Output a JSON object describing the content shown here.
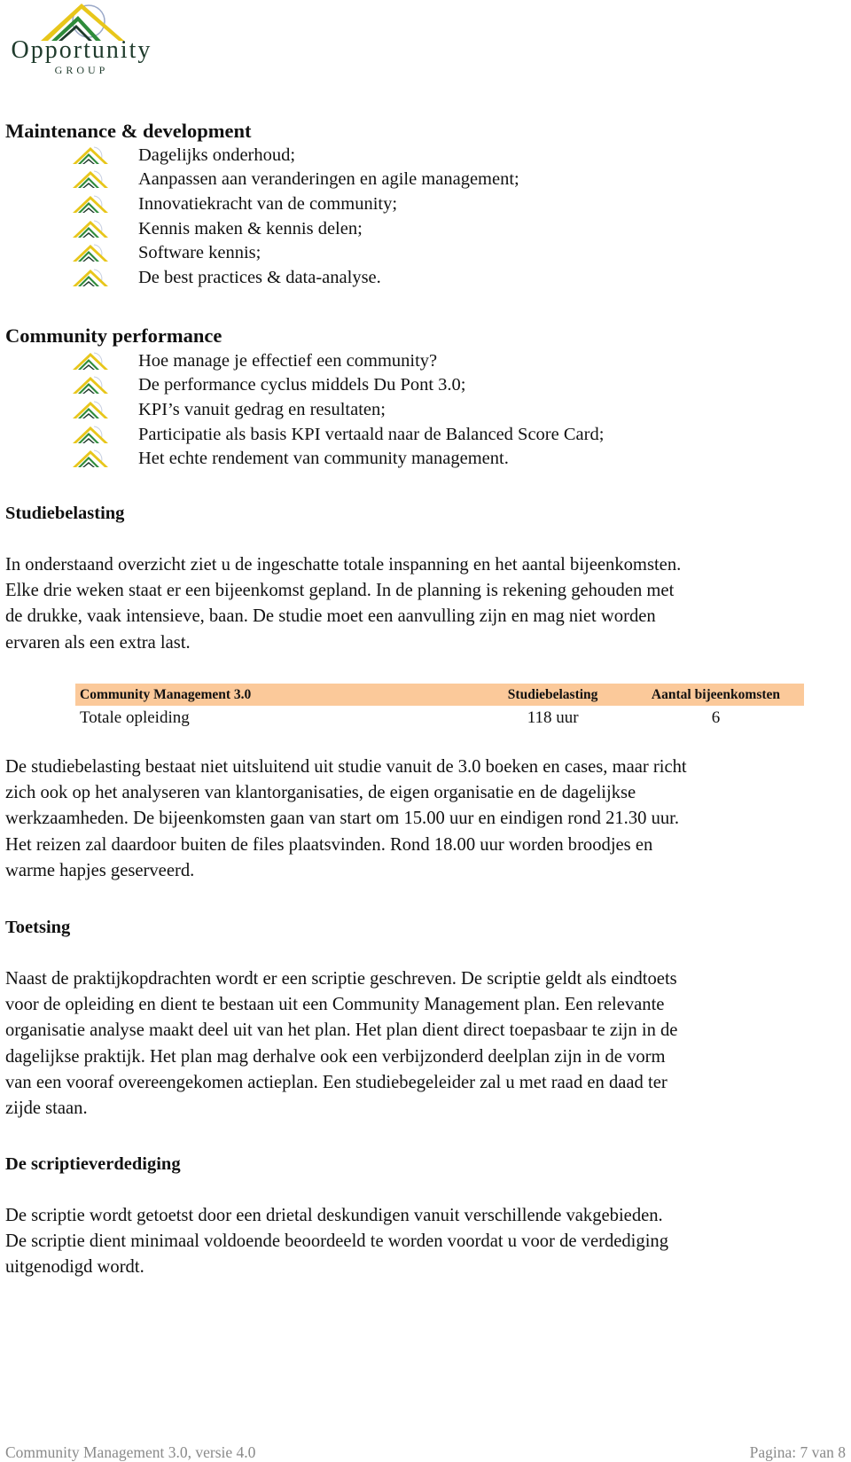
{
  "logo": {
    "name": "Opportunity",
    "sub": "GROUP",
    "colors": {
      "yellow": "#e8c61a",
      "green": "#2e8b3a",
      "dark": "#1f3b2c",
      "arc": "#9aa8c8"
    }
  },
  "sections": {
    "maintenance": {
      "title": "Maintenance & development",
      "items": [
        "Dagelijks onderhoud;",
        "Aanpassen aan veranderingen en agile management;",
        "Innovatiekracht van de community;",
        "Kennis maken & kennis delen;",
        "Software kennis;",
        "De best practices & data-analyse."
      ]
    },
    "performance": {
      "title": "Community performance",
      "items": [
        "Hoe manage je effectief een community?",
        "De performance cyclus middels Du Pont 3.0;",
        "KPI’s vanuit gedrag en resultaten;",
        "Participatie als basis KPI vertaald naar de Balanced Score Card;",
        "Het echte rendement van community management."
      ]
    },
    "studiebelasting": {
      "title": "Studiebelasting",
      "intro": [
        "In onderstaand overzicht ziet u de ingeschatte totale inspanning en het aantal bijeenkomsten.",
        "Elke drie weken staat er een bijeenkomst gepland. In de planning is rekening gehouden met",
        "de drukke, vaak intensieve, baan. De studie moet een aanvulling zijn en mag niet worden",
        "ervaren als een extra last."
      ],
      "table": {
        "header_color": "#fbc99a",
        "headers": [
          "Community Management 3.0",
          "Studiebelasting",
          "Aantal bijeenkomsten"
        ],
        "rows": [
          [
            "Totale opleiding",
            "118 uur",
            "6"
          ]
        ]
      },
      "detail": [
        "De studiebelasting bestaat niet uitsluitend uit studie vanuit de 3.0 boeken en cases, maar richt",
        "zich ook op het analyseren van klantorganisaties, de eigen organisatie en de dagelijkse",
        "werkzaamheden. De bijeenkomsten gaan van start om 15.00 uur en eindigen rond 21.30 uur.",
        "Het reizen zal daardoor buiten de files plaatsvinden. Rond 18.00 uur worden broodjes en",
        "warme hapjes geserveerd."
      ]
    },
    "toetsing": {
      "title": "Toetsing",
      "body": [
        "Naast de praktijkopdrachten wordt er een scriptie geschreven. De scriptie geldt als eindtoets",
        "voor de opleiding en dient te bestaan uit een Community Management plan. Een relevante",
        "organisatie analyse maakt deel uit van het plan. Het plan dient direct toepasbaar te zijn in de",
        "dagelijkse praktijk. Het plan mag derhalve ook een verbijzonderd deelplan zijn in de vorm",
        "van een vooraf overeengekomen actieplan. Een studiebegeleider zal u met raad en daad ter",
        "zijde staan."
      ]
    },
    "verdediging": {
      "title": "De scriptieverdediging",
      "body": [
        "De scriptie wordt getoetst door een drietal deskundigen vanuit verschillende vakgebieden.",
        "De scriptie dient minimaal voldoende beoordeeld te worden voordat u voor de verdediging",
        "uitgenodigd wordt."
      ]
    }
  },
  "footer": {
    "left": "Community Management 3.0, versie 4.0",
    "right": "Pagina: 7 van 8"
  }
}
